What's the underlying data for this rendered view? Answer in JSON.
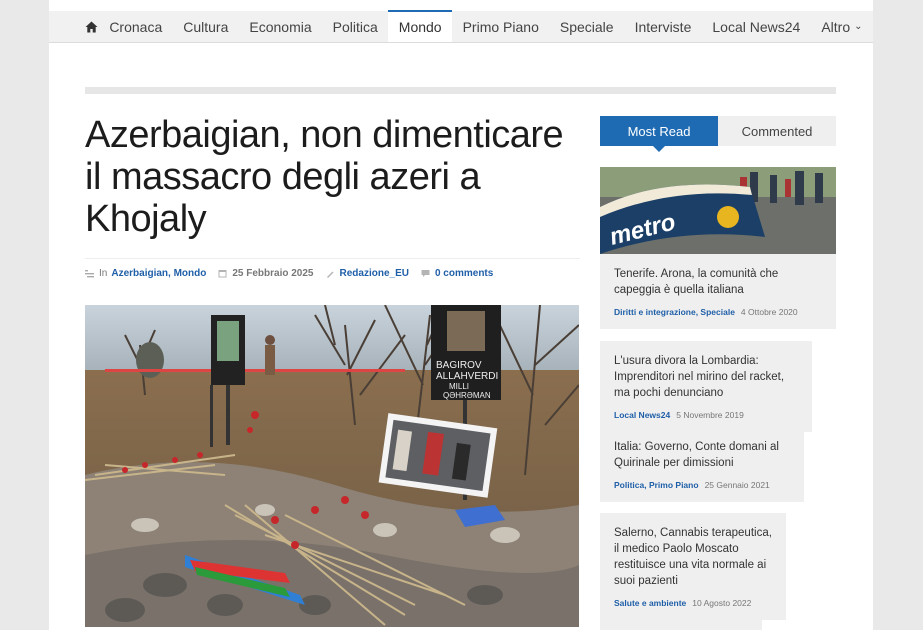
{
  "nav": {
    "items": [
      {
        "label": "Cronaca"
      },
      {
        "label": "Cultura"
      },
      {
        "label": "Economia"
      },
      {
        "label": "Politica"
      },
      {
        "label": "Mondo"
      },
      {
        "label": "Primo Piano"
      },
      {
        "label": "Speciale"
      },
      {
        "label": "Interviste"
      },
      {
        "label": "Local News24"
      },
      {
        "label": "Altro"
      }
    ],
    "active": "Mondo"
  },
  "article": {
    "title": "Azerbaigian, non dimenticare il massacro degli azeri a Khojaly",
    "meta": {
      "in_label": "In",
      "categories": "Azerbaigian, Mondo",
      "date": "25 Febbraio 2025",
      "author": "Redazione_EU",
      "comments": "0 comments"
    },
    "image_text": {
      "sign_line1": "BAGIROV",
      "sign_line2": "ALLAHVERDI",
      "sign_line3": "MILLI",
      "sign_line4": "QƏHRƏMAN"
    }
  },
  "sidebar": {
    "tabs": {
      "most_read": "Most Read",
      "commented": "Commented"
    },
    "image_text": {
      "brand": "metro"
    },
    "cards": [
      {
        "title": "Tenerife. Arona, la comunità che capeggia è quella italiana",
        "category": "Diritti e integrazione, Speciale",
        "date": "4 Ottobre 2020"
      },
      {
        "title": "L'usura divora la Lombardia: Imprenditori nel mirino del racket, ma pochi denunciano",
        "category": "Local News24",
        "date": "5 Novembre 2019"
      },
      {
        "title": "Italia: Governo, Conte domani al Quirinale per dimissioni",
        "category": "Politica, Primo Piano",
        "date": "25 Gennaio 2021"
      },
      {
        "title": "Salerno, Cannabis terapeutica, il medico Paolo Moscato restituisce una vita normale ai suoi pazienti",
        "category": "Salute e ambiente",
        "date": "10 Agosto 2022"
      }
    ]
  },
  "colors": {
    "accent": "#1f6bb3",
    "link": "#1f5fa8",
    "card_bg": "#efefef"
  },
  "icons": [
    "home-icon",
    "folder-icon",
    "calendar-icon",
    "author-icon",
    "comment-icon",
    "chevron-down-icon"
  ]
}
